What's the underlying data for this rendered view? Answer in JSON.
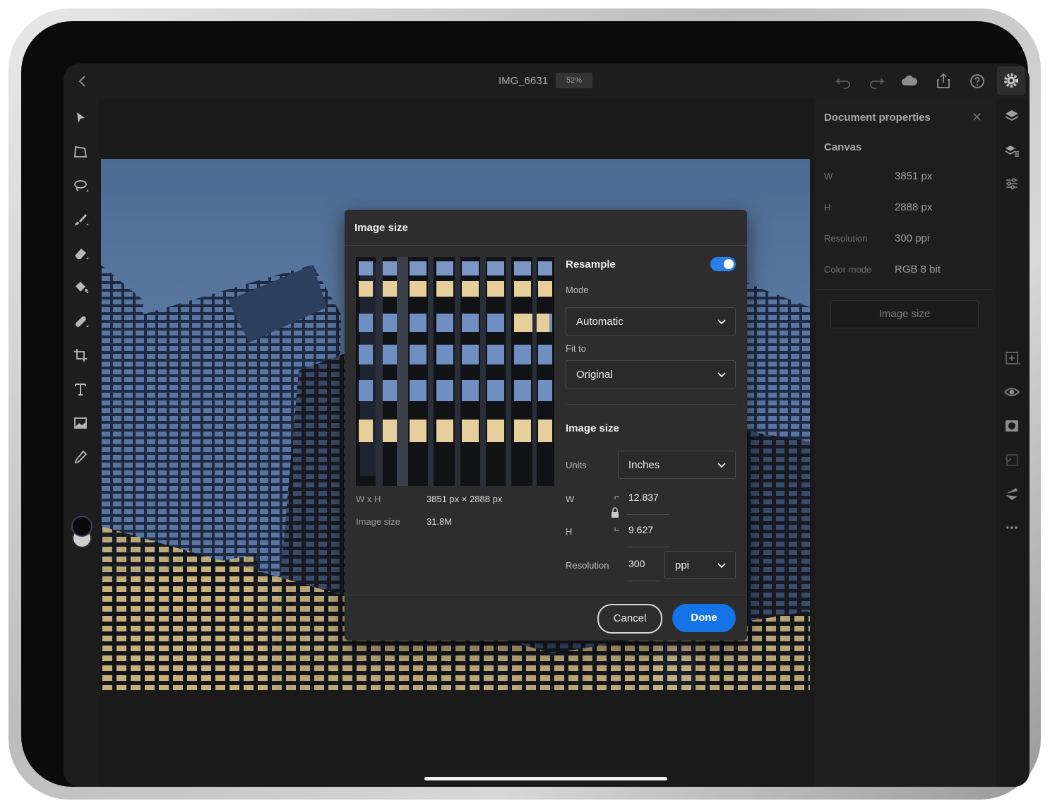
{
  "app": {
    "doc_title": "IMG_6631",
    "zoom": "52%"
  },
  "toolbar_top": {
    "icons": [
      "back-icon",
      "undo-icon",
      "redo-icon",
      "cloud-icon",
      "share-icon",
      "help-icon",
      "settings-icon"
    ]
  },
  "tools": [
    "select-icon",
    "transform-icon",
    "lasso-icon",
    "brush-icon",
    "eraser-icon",
    "fill-icon",
    "healing-icon",
    "crop-icon",
    "type-icon",
    "place-image-icon",
    "eyedropper-icon"
  ],
  "panel": {
    "title": "Document properties",
    "section": "Canvas",
    "props": [
      {
        "label": "W",
        "value": "3851 px"
      },
      {
        "label": "H",
        "value": "2888 px"
      },
      {
        "label": "Resolution",
        "value": "300 ppi"
      },
      {
        "label": "Color mode",
        "value": "RGB  8 bit"
      }
    ],
    "image_size_button": "Image size"
  },
  "rail": {
    "icons": [
      "layers-icon",
      "layer-properties-icon",
      "adjustments-icon",
      "add-layer-icon",
      "visibility-icon",
      "mask-icon",
      "clip-icon",
      "fx-icon",
      "more-icon"
    ]
  },
  "dialog": {
    "title": "Image size",
    "info": [
      {
        "label": "W x H",
        "value": "3851 px  ×  2888 px"
      },
      {
        "label": "Image size",
        "value": "31.8M"
      }
    ],
    "resample_label": "Resample",
    "resample_on": true,
    "mode_label": "Mode",
    "mode_value": "Automatic",
    "fit_label": "Fit to",
    "fit_value": "Original",
    "section_title": "Image size",
    "units_label": "Units",
    "units_value": "Inches",
    "w_label": "W",
    "w_value": "12.837",
    "h_label": "H",
    "h_value": "9.627",
    "resolution_label": "Resolution",
    "resolution_value": "300",
    "resolution_unit": "ppi",
    "cancel_label": "Cancel",
    "done_label": "Done"
  },
  "colors": {
    "accent": "#1473e6",
    "toggle": "#2b7de9",
    "dialog_bg": "#2d2d2d",
    "app_bg": "#1a1a1a"
  }
}
